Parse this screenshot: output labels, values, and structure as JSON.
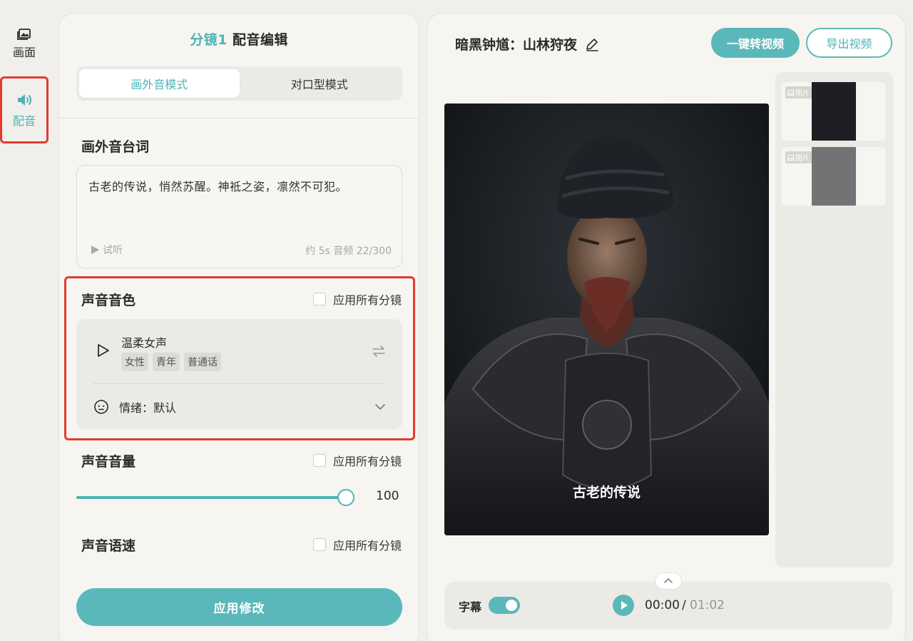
{
  "rail": {
    "items": [
      {
        "label": "画面",
        "icon": "image-icon",
        "active": false
      },
      {
        "label": "配音",
        "icon": "speaker-icon",
        "active": true
      }
    ]
  },
  "editor": {
    "title_prefix": "分镜1",
    "title": "配音编辑",
    "tabs": [
      {
        "label": "画外音模式",
        "active": true
      },
      {
        "label": "对口型模式",
        "active": false
      }
    ],
    "script": {
      "label": "画外音台词",
      "text": "古老的传说，悄然苏醒。神祗之姿，凛然不可犯。",
      "listen_label": "试听",
      "meta": "约 5s 音频 22/300"
    },
    "timbre": {
      "label": "声音音色",
      "apply_all": "应用所有分镜",
      "voice_name": "温柔女声",
      "tags": [
        "女性",
        "青年",
        "普通话"
      ],
      "emotion": "情绪：默认"
    },
    "volume": {
      "label": "声音音量",
      "apply_all": "应用所有分镜",
      "value": "100",
      "level": 1.0
    },
    "speed": {
      "label": "声音语速",
      "apply_all": "应用所有分镜"
    },
    "apply_button": "应用修改"
  },
  "preview": {
    "project_title": "暗黑钟馗：山林狩夜",
    "convert_button": "一键转视频",
    "export_button": "导出视频",
    "subtitle_text": "古老的传说",
    "thumbnails": [
      {
        "badge": "图片"
      },
      {
        "badge": "图片"
      }
    ],
    "player": {
      "subtitle_label": "字幕",
      "subtitle_on": true,
      "time_current": "00:00",
      "time_separator": "/",
      "time_total": "01:02"
    }
  },
  "colors": {
    "accent": "#5bb8ba",
    "highlight": "#e23b2e",
    "background": "#f0efeb"
  }
}
